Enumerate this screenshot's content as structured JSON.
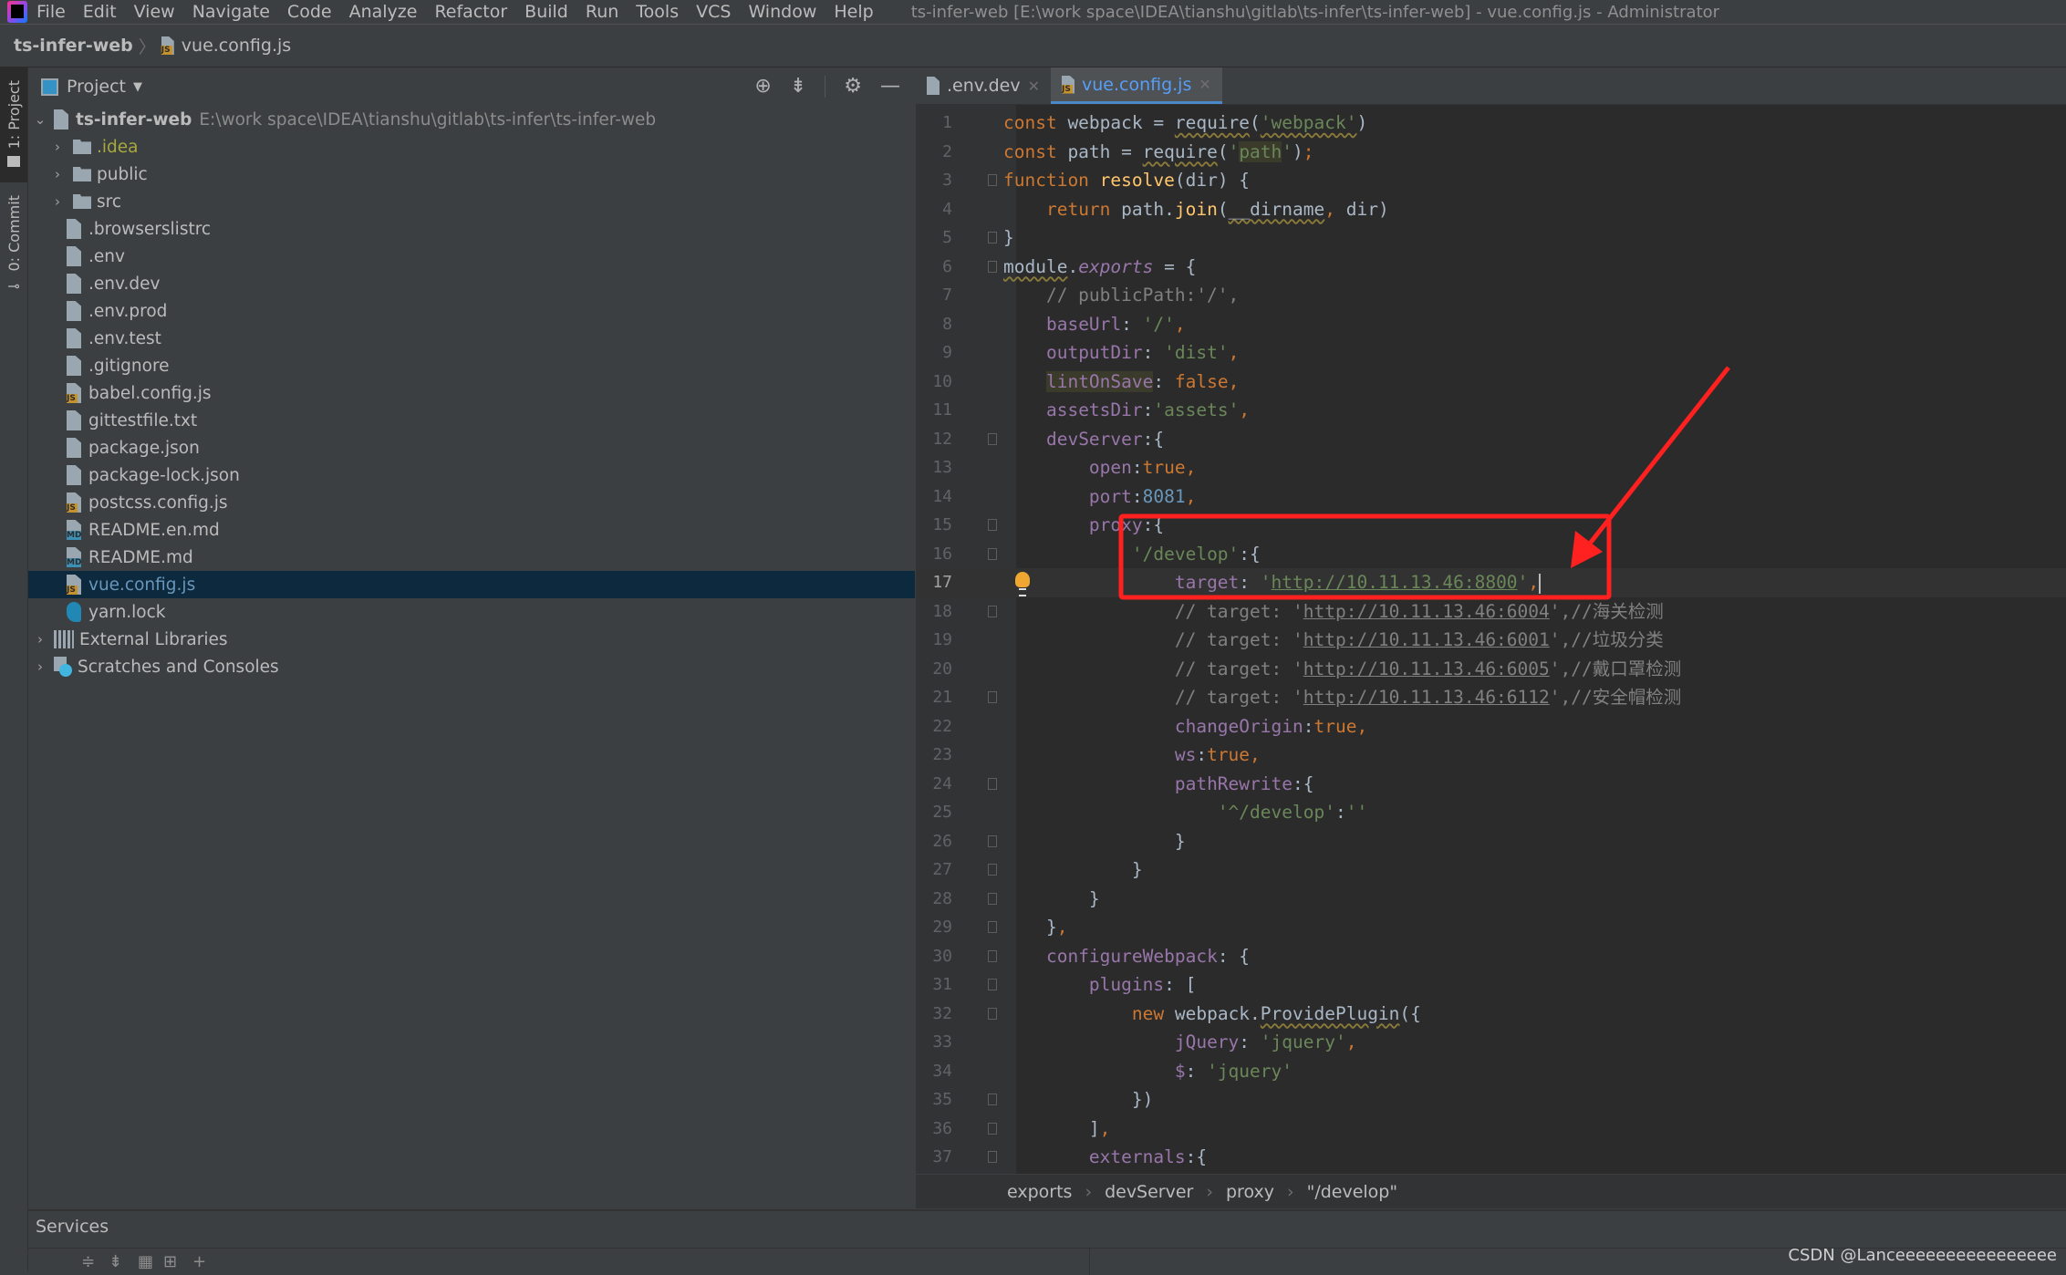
{
  "menubar": {
    "items": [
      "File",
      "Edit",
      "View",
      "Navigate",
      "Code",
      "Analyze",
      "Refactor",
      "Build",
      "Run",
      "Tools",
      "VCS",
      "Window",
      "Help"
    ],
    "window_title": "ts-infer-web [E:\\work space\\IDEA\\tianshu\\gitlab\\ts-infer\\ts-infer-web] - vue.config.js - Administrator"
  },
  "navbar": {
    "project": "ts-infer-web",
    "file": "vue.config.js"
  },
  "leftstrip": {
    "project_tab": "1: Project",
    "commit_tab": "0: Commit"
  },
  "project_panel": {
    "title": "Project",
    "root": {
      "name": "ts-infer-web",
      "path": "E:\\work space\\IDEA\\tianshu\\gitlab\\ts-infer\\ts-infer-web"
    },
    "items": [
      {
        "name": ".idea",
        "type": "folder"
      },
      {
        "name": "public",
        "type": "folder"
      },
      {
        "name": "src",
        "type": "folder"
      },
      {
        "name": ".browserslistrc",
        "type": "text"
      },
      {
        "name": ".env",
        "type": "text"
      },
      {
        "name": ".env.dev",
        "type": "text"
      },
      {
        "name": ".env.prod",
        "type": "text"
      },
      {
        "name": ".env.test",
        "type": "text"
      },
      {
        "name": ".gitignore",
        "type": "ignore"
      },
      {
        "name": "babel.config.js",
        "type": "js"
      },
      {
        "name": "gittestfile.txt",
        "type": "text"
      },
      {
        "name": "package.json",
        "type": "json"
      },
      {
        "name": "package-lock.json",
        "type": "json"
      },
      {
        "name": "postcss.config.js",
        "type": "js"
      },
      {
        "name": "README.en.md",
        "type": "md"
      },
      {
        "name": "README.md",
        "type": "md"
      },
      {
        "name": "vue.config.js",
        "type": "js",
        "selected": true
      },
      {
        "name": "yarn.lock",
        "type": "yarn"
      }
    ],
    "external_libraries": "External Libraries",
    "scratches": "Scratches and Consoles"
  },
  "editor": {
    "tabs": [
      {
        "label": ".env.dev",
        "active": false
      },
      {
        "label": "vue.config.js",
        "active": true
      }
    ],
    "current_line": 17,
    "breadcrumbs": [
      "exports",
      "devServer",
      "proxy",
      "\"/develop\""
    ]
  },
  "code_lines": [
    "const webpack = require('webpack')",
    "const path = require('path');",
    "function resolve(dir) {",
    "    return path.join(__dirname, dir)",
    "}",
    "module.exports = {",
    "    // publicPath:'/',",
    "    baseUrl: '/',",
    "    outputDir: 'dist',",
    "    lintOnSave: false,",
    "    assetsDir:'assets',",
    "    devServer:{",
    "        open:true,",
    "        port:8081,",
    "        proxy:{",
    "            '/develop':{",
    "                target: 'http://10.11.13.46:8800',",
    "                // target: 'http://10.11.13.46:6004',//海关检测",
    "                // target: 'http://10.11.13.46:6001',//垃圾分类",
    "                // target: 'http://10.11.13.46:6005',//戴口罩检测",
    "                // target: 'http://10.11.13.46:6112',//安全帽检测",
    "                changeOrigin:true,",
    "                ws:true,",
    "                pathRewrite:{",
    "                    '^/develop':''",
    "                }",
    "            }",
    "        }",
    "    },",
    "    configureWebpack: {",
    "        plugins: [",
    "            new webpack.ProvidePlugin({",
    "                jQuery: 'jquery',",
    "                $: 'jquery'",
    "            })",
    "        ],",
    "        externals:{"
  ],
  "services": {
    "title": "Services"
  },
  "watermark": "CSDN @Lanceeeeeeeeeeeeeeee",
  "annotation": {
    "color": "#ff2020",
    "highlighted_line": 17
  },
  "colors": {
    "keyword": "#cc7832",
    "string": "#6a8759",
    "property": "#9876aa",
    "function": "#ffc66d",
    "number": "#6897bb",
    "comment": "#808080",
    "selection": "#0d293e",
    "accent": "#4a88c7"
  }
}
